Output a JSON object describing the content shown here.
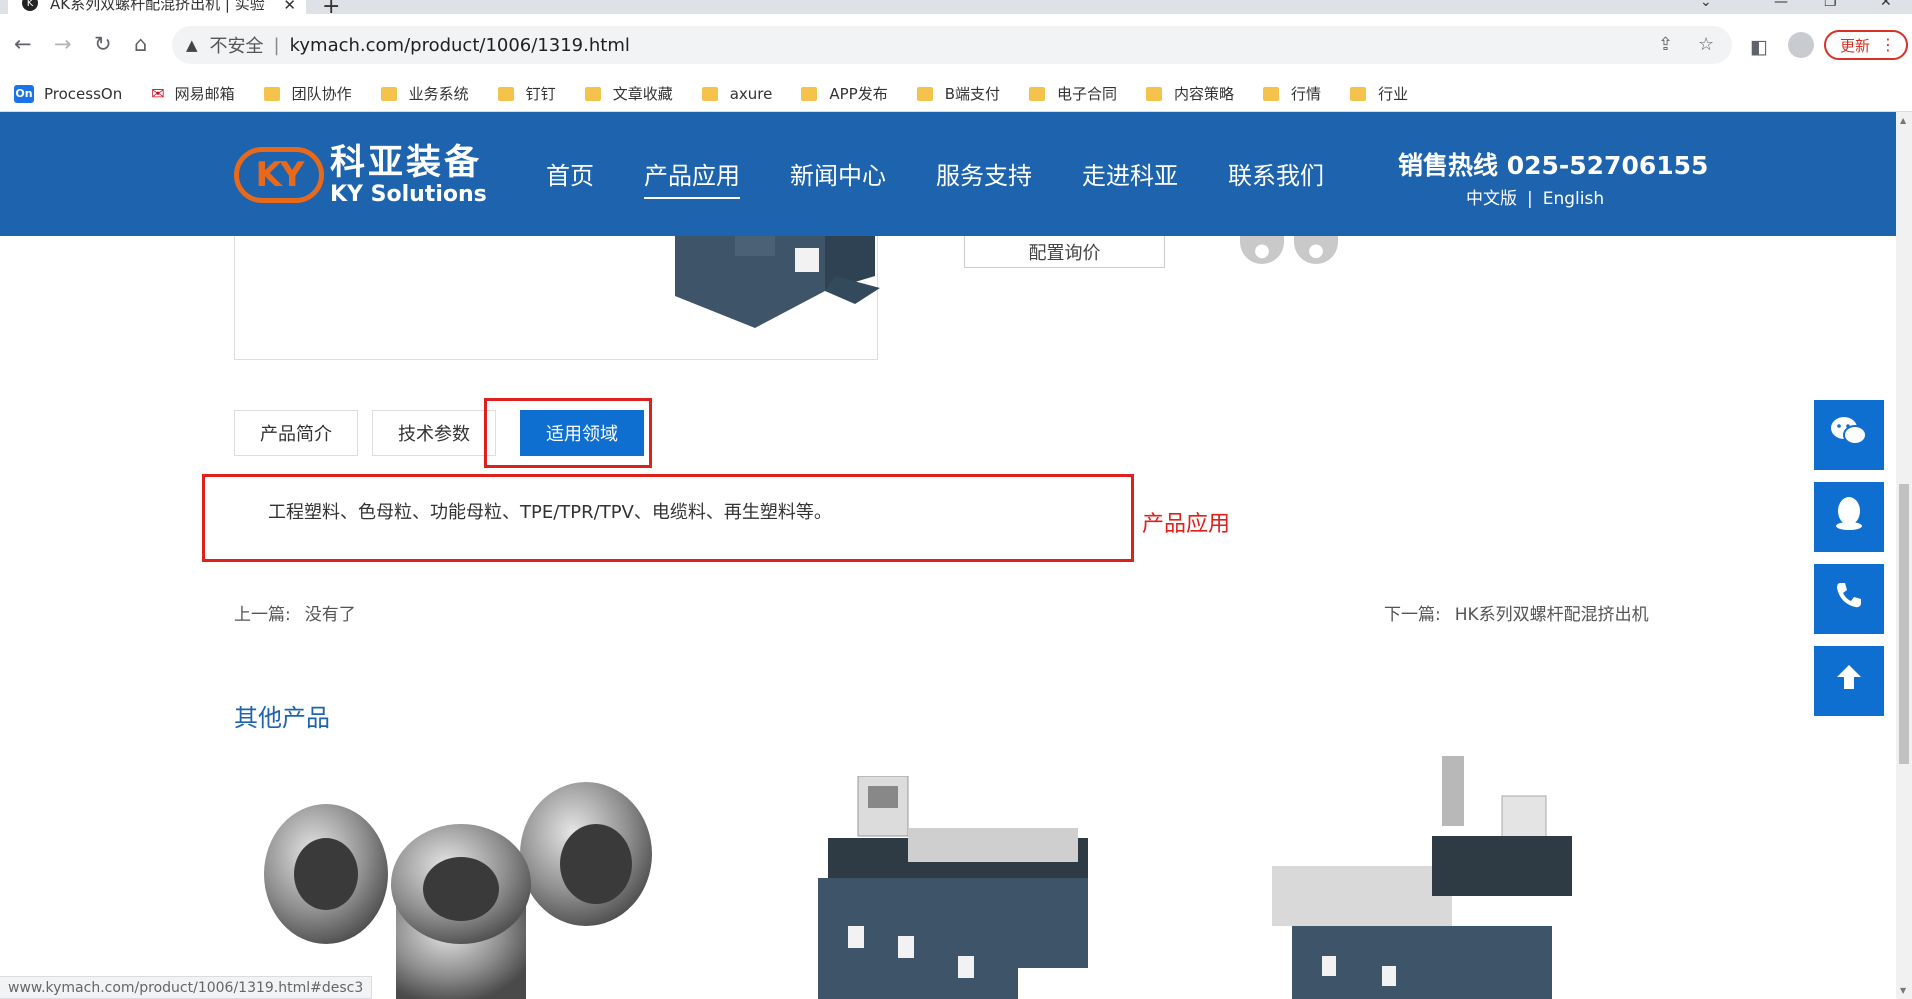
{
  "browser": {
    "tab_title": "AK系列双螺杆配混挤出机 | 实验",
    "tab_close": "✕",
    "new_tab": "+",
    "insecure_label": "不安全",
    "separator": "|",
    "url": "kymach.com/product/1006/1319.html",
    "update_label": "更新",
    "status_url": "www.kymach.com/product/1006/1319.html#desc3"
  },
  "bookmarks": [
    {
      "label": "ProcessOn",
      "type": "processon"
    },
    {
      "label": "网易邮箱",
      "type": "netease"
    },
    {
      "label": "团队协作",
      "type": "folder"
    },
    {
      "label": "业务系统",
      "type": "folder"
    },
    {
      "label": "钉钉",
      "type": "folder"
    },
    {
      "label": "文章收藏",
      "type": "folder"
    },
    {
      "label": "axure",
      "type": "folder"
    },
    {
      "label": "APP发布",
      "type": "folder"
    },
    {
      "label": "B端支付",
      "type": "folder"
    },
    {
      "label": "电子合同",
      "type": "folder"
    },
    {
      "label": "内容策略",
      "type": "folder"
    },
    {
      "label": "行情",
      "type": "folder"
    },
    {
      "label": "行业",
      "type": "folder"
    }
  ],
  "site": {
    "logo_mark": "KY",
    "logo_cn": "科亚装备",
    "logo_en": "KY Solutions",
    "nav": [
      "首页",
      "产品应用",
      "新闻中心",
      "服务支持",
      "走进科亚",
      "联系我们"
    ],
    "nav_active_index": 1,
    "hotline": "销售热线 025-52706155",
    "lang_cn": "中文版",
    "lang_sep": "|",
    "lang_en": "English",
    "brand_color": "#1e63ae",
    "accent_color": "#0f6fd1",
    "logo_color": "#e8691a"
  },
  "product": {
    "quote_button": "配置询价",
    "tabs": [
      "产品简介",
      "技术参数",
      "适用领域"
    ],
    "active_tab_index": 2,
    "application_text": "工程塑料、色母粒、功能母粒、TPE/TPR/TPV、电缆料、再生塑料等。",
    "annotation": "产品应用",
    "annotation_color": "#e0201c",
    "prev_label": "上一篇:",
    "prev_value": "没有了",
    "next_label": "下一篇:",
    "next_value": "HK系列双螺杆配混挤出机",
    "other_products_title": "其他产品"
  },
  "floating_buttons": [
    "wechat-icon",
    "qq-icon",
    "phone-icon",
    "arrow-up-icon"
  ]
}
